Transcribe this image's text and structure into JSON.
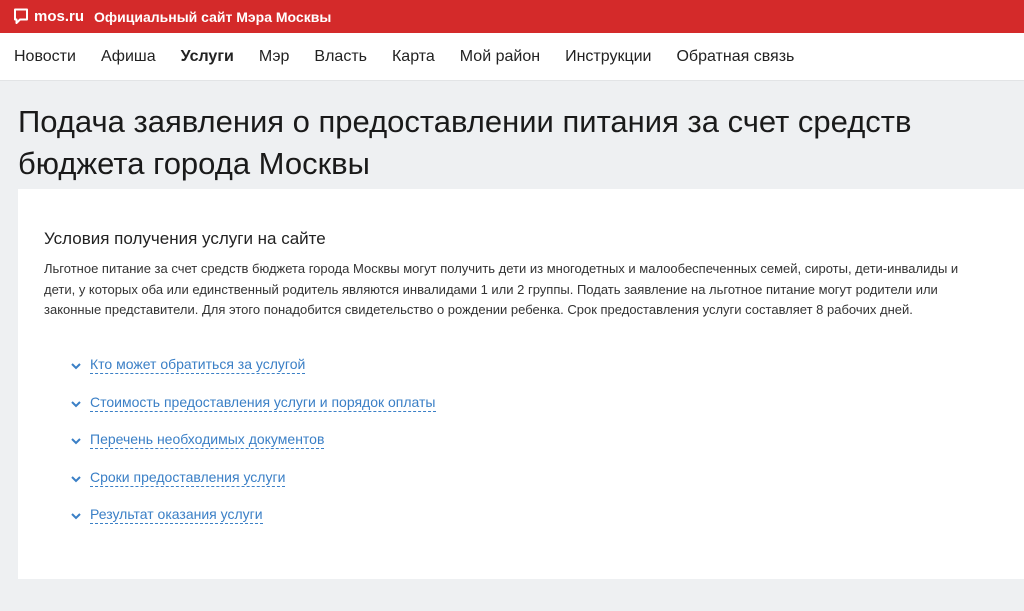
{
  "header": {
    "logo_text": "mos.ru",
    "site_title": "Официальный сайт Мэра Москвы",
    "logo_icon": "speech-bubble-icon",
    "brand_color": "#d42a2a"
  },
  "nav": {
    "items": [
      {
        "label": "Новости"
      },
      {
        "label": "Афиша"
      },
      {
        "label": "Услуги",
        "active": true
      },
      {
        "label": "Мэр"
      },
      {
        "label": "Власть"
      },
      {
        "label": "Карта"
      },
      {
        "label": "Мой район"
      },
      {
        "label": "Инструкции"
      },
      {
        "label": "Обратная связь"
      }
    ]
  },
  "page": {
    "title": "Подача заявления о предоставлении питания за счет средств бюджета города Москвы"
  },
  "conditions": {
    "title": "Условия получения услуги на сайте",
    "text": "Льготное питание за счет средств бюджета города Москвы могут получить дети из многодетных и малообеспеченных семей, сироты, дети-инвалиды и дети, у которых оба или единственный родитель являются инвалидами 1 или 2 группы. Подать заявление на льготное питание могут родители или законные представители. Для этого понадобится свидетельство о рождении ребенка. Срок предоставления услуги составляет 8 рабочих дней."
  },
  "accordion": {
    "items": [
      {
        "label": "Кто может обратиться за услугой"
      },
      {
        "label": "Стоимость предоставления услуги и порядок оплаты"
      },
      {
        "label": "Перечень необходимых документов"
      },
      {
        "label": "Сроки предоставления услуги"
      },
      {
        "label": "Результат оказания услуги"
      }
    ],
    "icon": "chevron-down-icon",
    "link_color": "#3a7fc6"
  }
}
